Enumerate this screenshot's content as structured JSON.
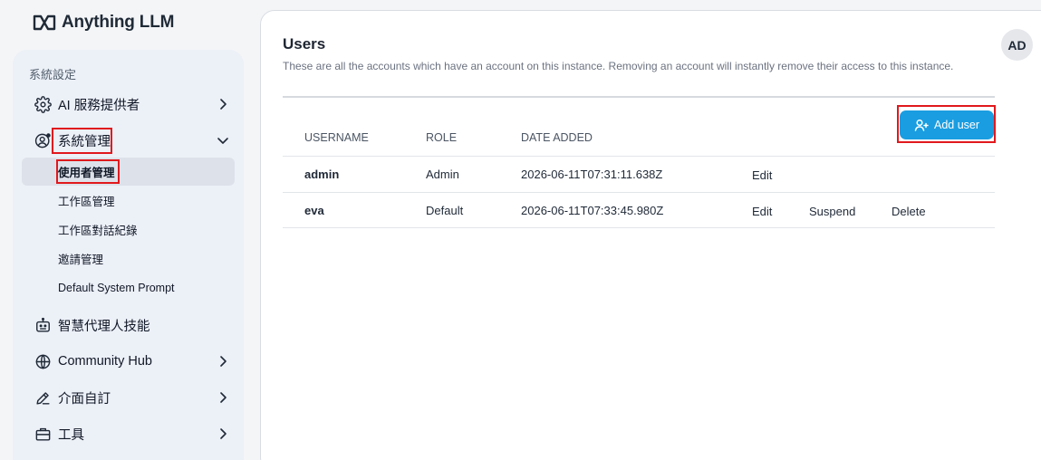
{
  "app": {
    "name": "Anything LLM"
  },
  "sidebar": {
    "heading": "系統設定",
    "items": [
      {
        "label": "AI 服務提供者",
        "icon": "gear-icon",
        "has_submenu": true,
        "expanded": false
      },
      {
        "label": "系統管理",
        "icon": "user-gear-icon",
        "has_submenu": true,
        "expanded": true
      },
      {
        "label": "智慧代理人技能",
        "icon": "robot-icon",
        "has_submenu": false
      },
      {
        "label": "Community Hub",
        "icon": "globe-icon",
        "has_submenu": true,
        "expanded": false
      },
      {
        "label": "介面自訂",
        "icon": "pencil-icon",
        "has_submenu": true,
        "expanded": false
      },
      {
        "label": "工具",
        "icon": "briefcase-icon",
        "has_submenu": true,
        "expanded": false
      }
    ],
    "subitems": [
      {
        "label": "使用者管理",
        "active": true
      },
      {
        "label": "工作區管理",
        "active": false
      },
      {
        "label": "工作區對話紀錄",
        "active": false
      },
      {
        "label": "邀請管理",
        "active": false
      },
      {
        "label": "Default System Prompt",
        "active": false
      }
    ]
  },
  "main": {
    "title": "Users",
    "description": "These are all the accounts which have an account on this instance. Removing an account will instantly remove their access to this instance.",
    "add_button": "Add user",
    "columns": [
      "USERNAME",
      "ROLE",
      "DATE ADDED"
    ],
    "rows": [
      {
        "username": "admin",
        "role": "Admin",
        "date": "2026-06-11T07:31:11.638Z",
        "actions": [
          "Edit"
        ]
      },
      {
        "username": "eva",
        "role": "Default",
        "date": "2026-06-11T07:33:45.980Z",
        "actions": [
          "Edit",
          "Suspend",
          "Delete"
        ]
      }
    ]
  },
  "avatar": {
    "initials": "AD"
  },
  "colors": {
    "accent": "#1a9de1",
    "highlight": "#e0191d",
    "sidebar_bg": "#ecf0f7"
  }
}
